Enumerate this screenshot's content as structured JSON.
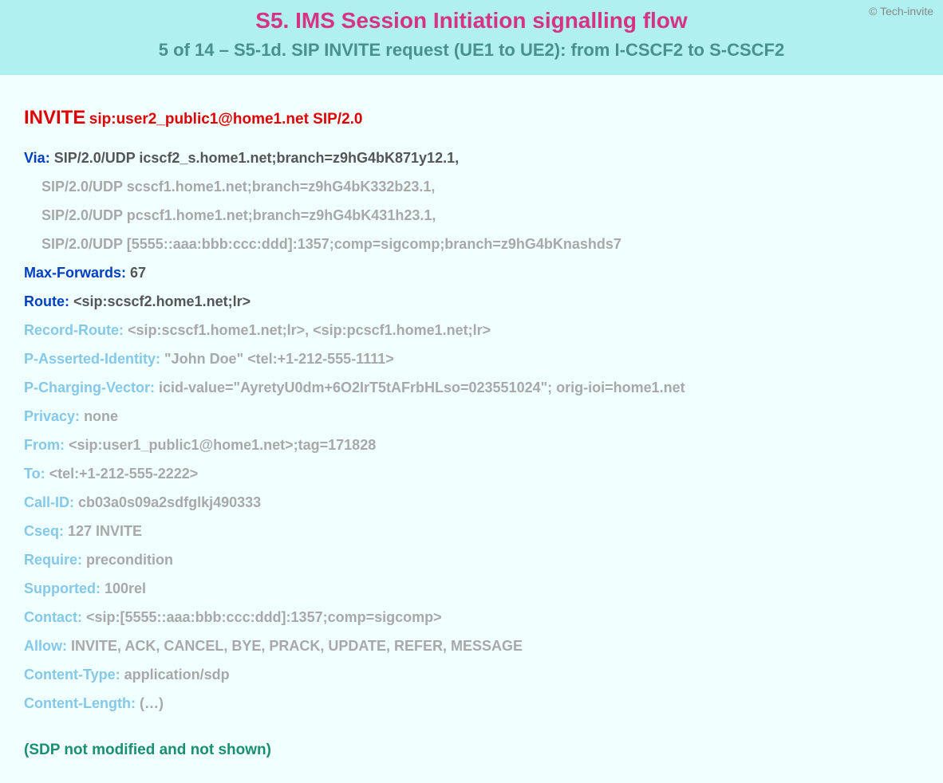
{
  "copyright": "© Tech-invite",
  "header": {
    "title": "S5. IMS Session Initiation signalling flow",
    "subtitle": "5 of 14 – S5-1d. SIP INVITE request (UE1 to UE2): from I-CSCF2 to S-CSCF2"
  },
  "invite": {
    "method": "INVITE",
    "uri": "sip:user2_public1@home1.net SIP/2.0"
  },
  "headers": {
    "via_name": "Via:",
    "via_value": " SIP/2.0/UDP icscf2_s.home1.net;branch=z9hG4bK871y12.1,",
    "via_cont1": "SIP/2.0/UDP scscf1.home1.net;branch=z9hG4bK332b23.1,",
    "via_cont2": "SIP/2.0/UDP pcscf1.home1.net;branch=z9hG4bK431h23.1,",
    "via_cont3": "SIP/2.0/UDP [5555::aaa:bbb:ccc:ddd]:1357;comp=sigcomp;branch=z9hG4bKnashds7",
    "maxfwd_name": "Max-Forwards:",
    "maxfwd_value": " 67",
    "route_name": "Route:",
    "route_value": " <sip:scscf2.home1.net;lr>",
    "recroute_name": "Record-Route:",
    "recroute_value": " <sip:scscf1.home1.net;lr>, <sip:pcscf1.home1.net;lr>",
    "pai_name": "P-Asserted-Identity:",
    "pai_value": " \"John Doe\" <tel:+1-212-555-1111>",
    "pcv_name": "P-Charging-Vector:",
    "pcv_value": " icid-value=\"AyretyU0dm+6O2IrT5tAFrbHLso=023551024\"; orig-ioi=home1.net",
    "privacy_name": "Privacy:",
    "privacy_value": " none",
    "from_name": "From:",
    "from_value": " <sip:user1_public1@home1.net>;tag=171828",
    "to_name": "To:",
    "to_value": " <tel:+1-212-555-2222>",
    "callid_name": "Call-ID:",
    "callid_value": " cb03a0s09a2sdfglkj490333",
    "cseq_name": "Cseq:",
    "cseq_value": " 127 INVITE",
    "require_name": "Require:",
    "require_value": " precondition",
    "supported_name": "Supported:",
    "supported_value": " 100rel",
    "contact_name": "Contact:",
    "contact_value": " <sip:[5555::aaa:bbb:ccc:ddd]:1357;comp=sigcomp>",
    "allow_name": "Allow:",
    "allow_value": " INVITE, ACK, CANCEL, BYE, PRACK, UPDATE, REFER, MESSAGE",
    "ctype_name": "Content-Type:",
    "ctype_value": " application/sdp",
    "clen_name": "Content-Length:",
    "clen_value": " (…)"
  },
  "sdp_note": "(SDP not modified and not shown)"
}
